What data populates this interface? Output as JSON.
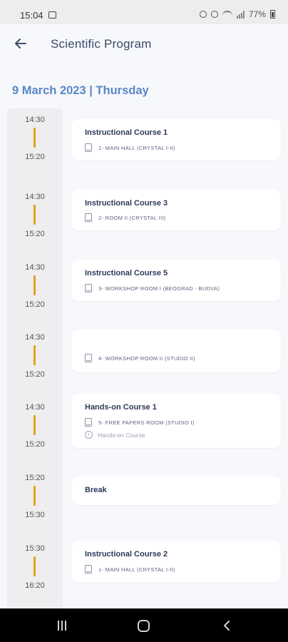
{
  "status_bar": {
    "time": "15:04",
    "battery": "77%"
  },
  "header": {
    "title": "Scientific Program"
  },
  "date_heading": "9 March 2023 | Thursday",
  "sessions": [
    {
      "start": "14:30",
      "end": "15:20",
      "title": "Instructional Course 1",
      "room": "1- MAIN HALL (CRYSTAL I-II)"
    },
    {
      "start": "14:30",
      "end": "15:20",
      "title": "Instructional Course 3",
      "room": "2- ROOM II (CRYSTAL III)"
    },
    {
      "start": "14:30",
      "end": "15:20",
      "title": "Instructional Course 5",
      "room": "3- WORKSHOP ROOM I (BEOGRAD - BUDVA)"
    },
    {
      "start": "14:30",
      "end": "15:20",
      "title": "",
      "room": "4- WORKSHOP ROOM II (STUDIO II)"
    },
    {
      "start": "14:30",
      "end": "15:20",
      "title": "Hands-on Course 1",
      "room": "5- FREE PAPERS ROOM (STUDIO I)",
      "type": "Hands-on Course"
    },
    {
      "start": "15:20",
      "end": "15:30",
      "title": "Break"
    },
    {
      "start": "15:30",
      "end": "16:20",
      "title": "Instructional Course 2",
      "room": "1- MAIN HALL (CRYSTAL I-II)"
    }
  ],
  "colors": {
    "accent_bar": "#e3a21a",
    "date_heading": "#5a87c5",
    "title_text": "#2c3a57"
  }
}
